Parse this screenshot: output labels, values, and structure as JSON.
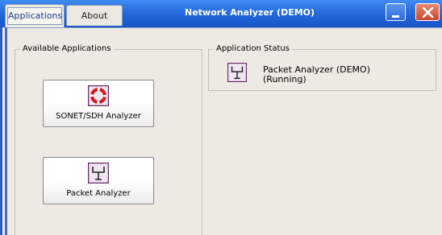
{
  "window": {
    "title": "Network Analyzer (DEMO)",
    "tabs": [
      {
        "label": "Applications",
        "active": true
      },
      {
        "label": "About",
        "active": false
      }
    ],
    "controls": [
      "minimize-icon",
      "close-icon"
    ]
  },
  "available_applications": {
    "title": "Available Applications",
    "apps": [
      {
        "label": "SONET/SDH Analyzer",
        "icon": "sonet-lifebuoy-icon"
      },
      {
        "label": "Packet Analyzer",
        "icon": "packet-network-icon"
      }
    ]
  },
  "application_status": {
    "title": "Application Status",
    "icon": "packet-network-icon",
    "name": "Packet Analyzer (DEMO)",
    "state": "(Running)"
  },
  "colors": {
    "titlebar_blue": "#2a6fe0",
    "window_bg": "#eceae2",
    "close_red": "#c9472a",
    "icon_purple": "#7a3a7a",
    "sonet_red": "#d11a1a"
  }
}
